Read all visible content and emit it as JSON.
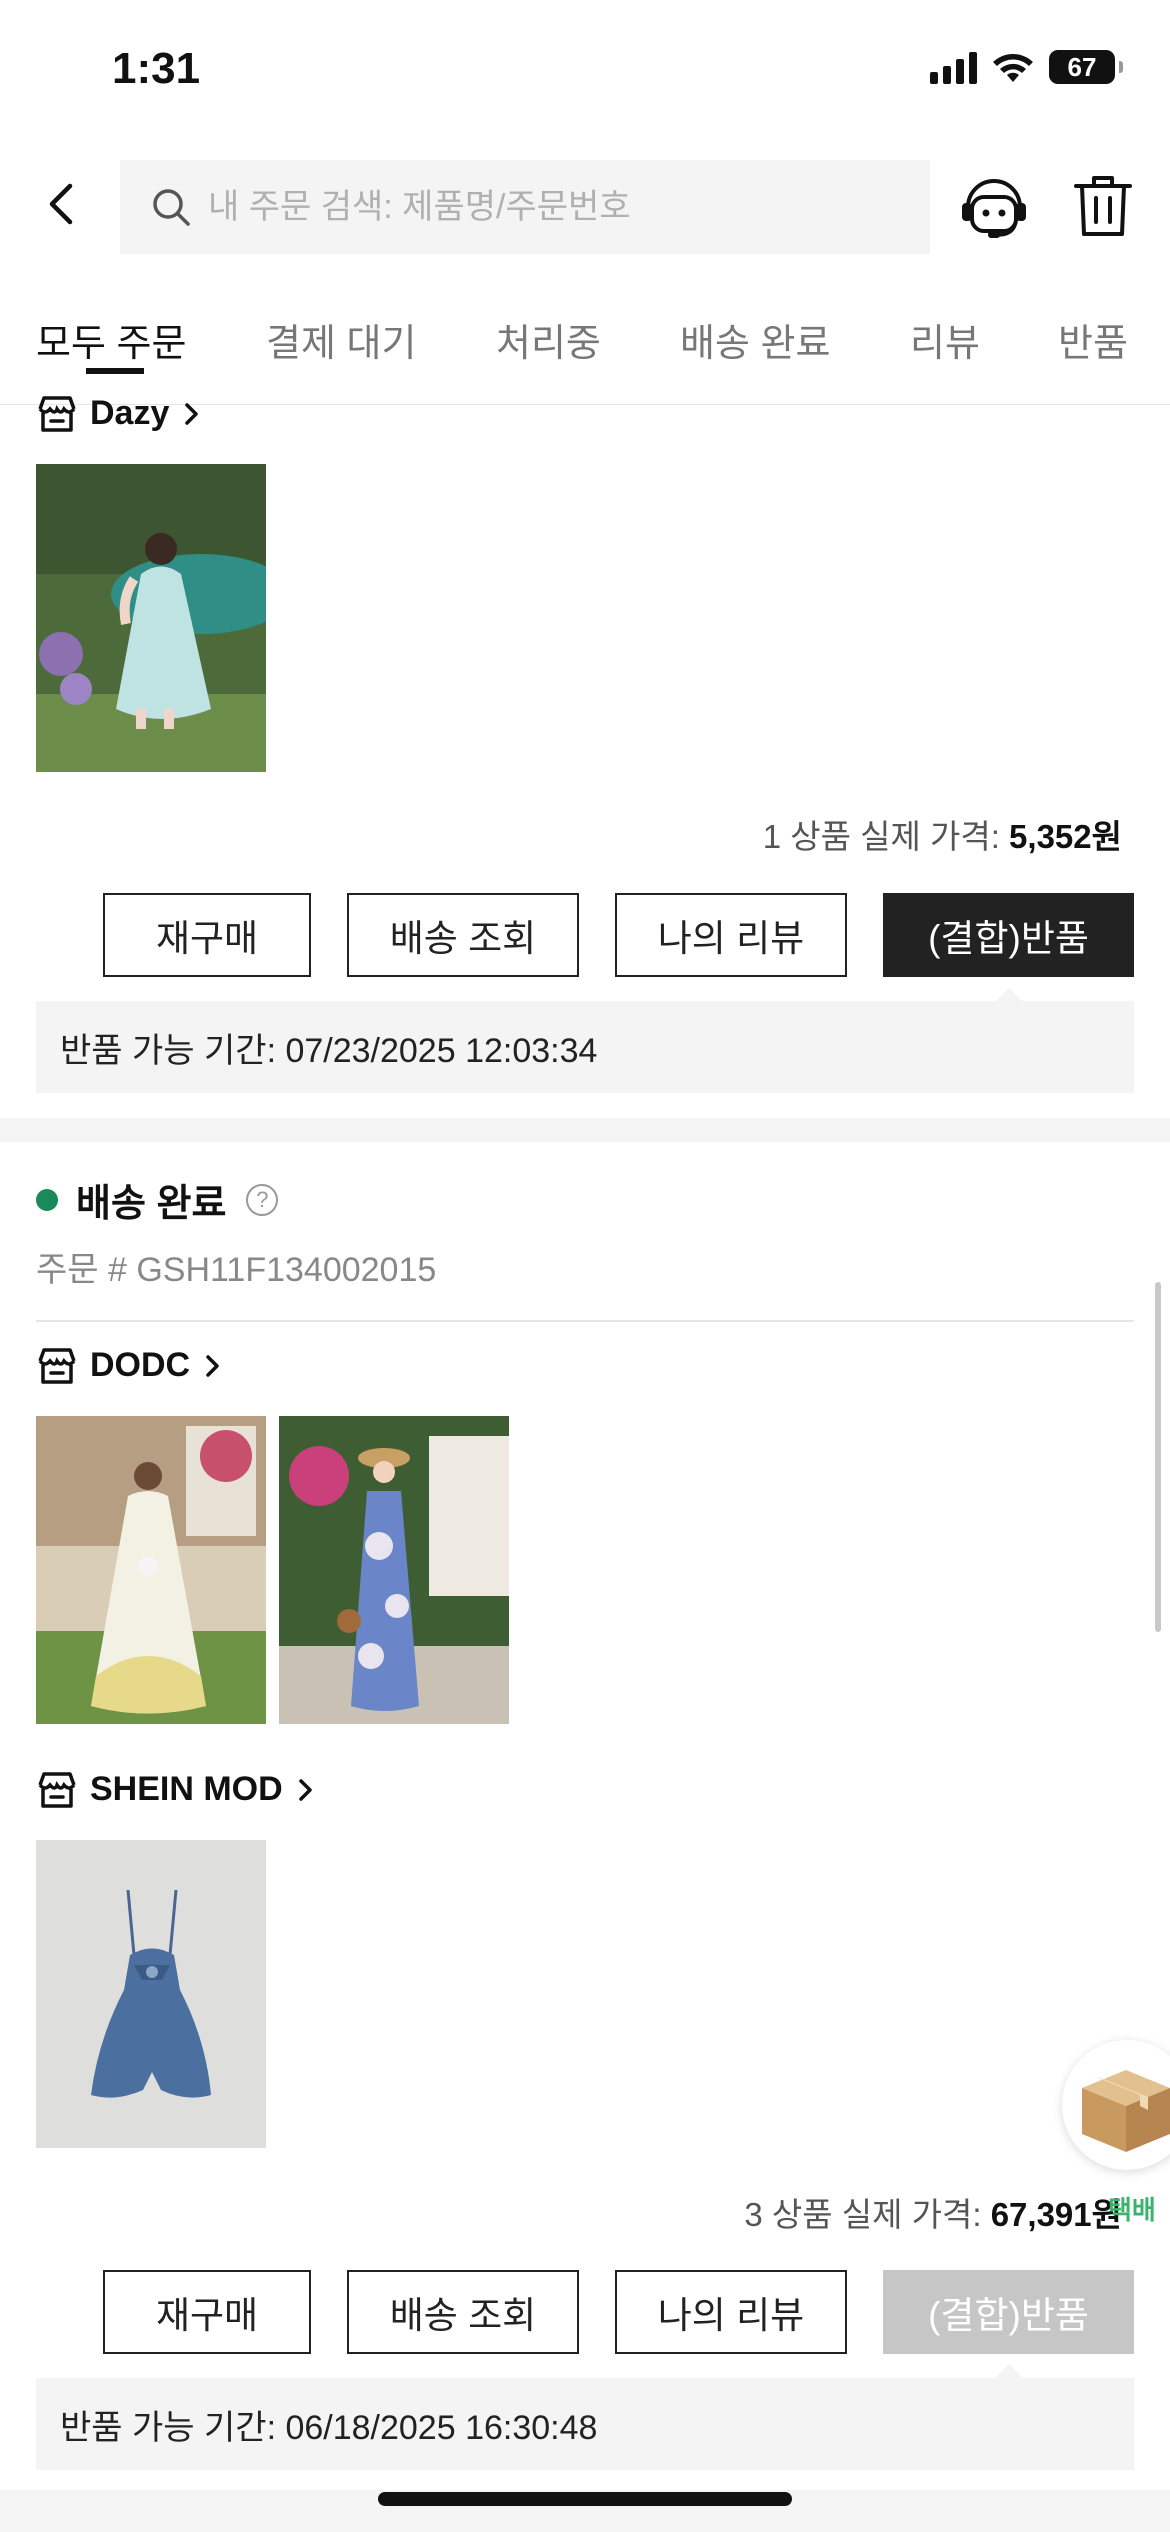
{
  "status_bar": {
    "time": "1:31",
    "battery": "67"
  },
  "header": {
    "search_placeholder": "내 주문 검색: 제품명/주문번호"
  },
  "tabs": [
    {
      "label": "모두 주문",
      "active": true
    },
    {
      "label": "결제 대기"
    },
    {
      "label": "처리중"
    },
    {
      "label": "배송 완료"
    },
    {
      "label": "리뷰"
    },
    {
      "label": "반품"
    }
  ],
  "order1": {
    "store": "Dazy",
    "price_prefix": "1 상품 실제 가격:",
    "price": "5,352원",
    "buttons": [
      "재구매",
      "배송 조회",
      "나의 리뷰",
      "(결합)반품"
    ],
    "notice": "반품 가능 기간: 07/23/2025 12:03:34"
  },
  "order2": {
    "status": "배송 완료",
    "order_no": "주문 #  GSH11F134002015",
    "store1": "DODC",
    "store2": "SHEIN MOD",
    "price_prefix": "3 상품 실제 가격:",
    "price": "67,391원",
    "buttons": [
      "재구매",
      "배송 조회",
      "나의 리뷰",
      "(결합)반품"
    ],
    "notice": "반품 가능 기간: 06/18/2025 16:30:48"
  },
  "floating": {
    "label": "택배"
  },
  "colors": {
    "status_green": "#1a8a5a",
    "button_dark": "#222222",
    "button_disabled": "#c6c6c6",
    "float_label": "#3bb36d"
  }
}
